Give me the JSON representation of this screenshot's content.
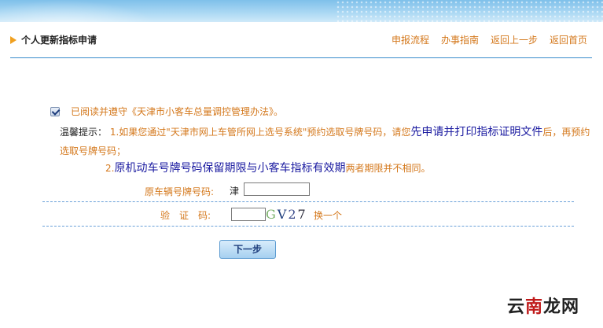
{
  "header": {
    "title": "个人更新指标申请",
    "nav": [
      "申报流程",
      "办事指南",
      "返回上一步",
      "返回首页"
    ]
  },
  "agreement": {
    "checked": true,
    "text": "已阅读并遵守《天津市小客车总量调控管理办法》。"
  },
  "tips": {
    "label": "温馨提示：",
    "line1_a": "1.如果您通过\"天津市网上车管所网上选号系统\"预约选取号牌号码，请您",
    "line1_b": "先申请并打印指标证明文件",
    "line1_c": "后，再预约选取号牌号码；",
    "line2_a": "2.",
    "line2_b": "原机动车号牌号码保留期限与小客车指标有效期",
    "line2_c": "两者期限并不相同。"
  },
  "form": {
    "plate_label": "原车辆号牌号码:",
    "plate_prefix": "津",
    "plate_value": "",
    "code_label": "验　证　码:",
    "code_value": "",
    "captcha_chars": [
      "G",
      "V",
      "2",
      "7"
    ],
    "refresh_label": "换一个"
  },
  "actions": {
    "next_label": "下一步"
  },
  "watermark": {
    "part1": "云",
    "part2": "南",
    "part3": "龙网"
  },
  "colors": {
    "accent_orange": "#d4781c",
    "divider_blue": "#3a8ccc",
    "button_blue": "#a6d0f0"
  }
}
